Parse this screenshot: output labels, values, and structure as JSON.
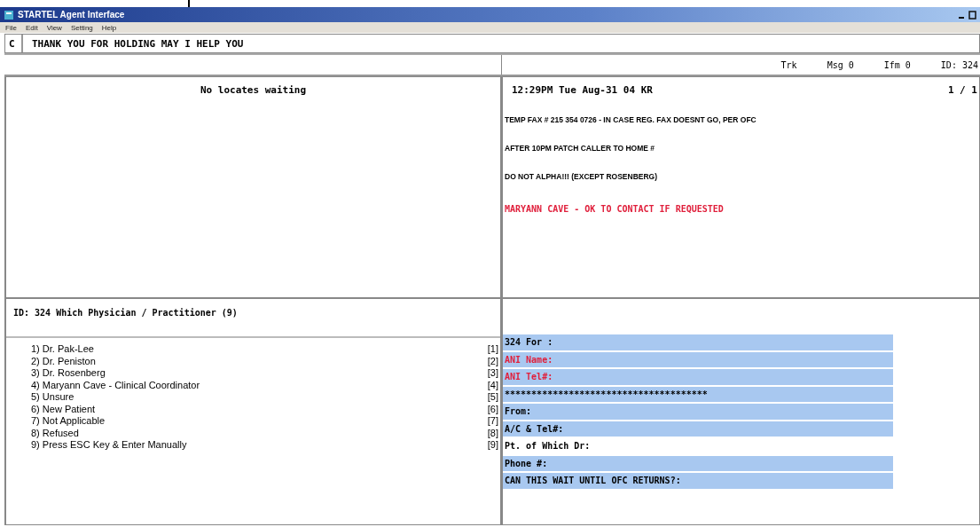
{
  "window": {
    "title": "STARTEL Agent Interface"
  },
  "menu": [
    "File",
    "Edit",
    "View",
    "Setting",
    "Help"
  ],
  "message_bar": {
    "code": "C",
    "text": "THANK YOU FOR HOLDING MAY I HELP YOU"
  },
  "status": [
    "Trk",
    "Msg 0",
    "Ifm 0",
    "ID: 324"
  ],
  "locates": {
    "text": "No locates waiting"
  },
  "info": {
    "header": "12:29PM Tue Aug-31 04 KR",
    "page": "1 / 1",
    "notes": [
      {
        "text": "TEMP FAX # 215 354 0726 - IN CASE REG. FAX DOESNT GO, PER OFC",
        "color": "#000000"
      },
      {
        "text": "AFTER 10PM PATCH CALLER TO HOME #",
        "color": "#000000"
      },
      {
        "text": "DO NOT ALPHA!!! (EXCEPT ROSENBERG)",
        "color": "#000000"
      },
      {
        "text": "MARYANN CAVE - OK TO CONTACT IF REQUESTED",
        "color": "#e0203c"
      }
    ]
  },
  "question": {
    "title": "ID: 324 Which Physician / Practitioner (9)",
    "options": [
      {
        "label": "1) Dr. Pak-Lee",
        "key": "[1]"
      },
      {
        "label": "2) Dr. Peniston",
        "key": "[2]"
      },
      {
        "label": "3) Dr. Rosenberg",
        "key": "[3]"
      },
      {
        "label": "4) Maryann Cave - Clinical Coordinator",
        "key": "[4]"
      },
      {
        "label": "5) Unsure",
        "key": "[5]"
      },
      {
        "label": "6) New Patient",
        "key": "[6]"
      },
      {
        "label": "7) Not Applicable",
        "key": "[7]"
      },
      {
        "label": "8) Refused",
        "key": "[8]"
      },
      {
        "label": "9) Press ESC Key & Enter Manually",
        "key": "[9]"
      }
    ]
  },
  "form": [
    {
      "label": "324 For :",
      "color": "#000000",
      "highlighted": true
    },
    {
      "label": "ANI Name:",
      "color": "#e0203c",
      "highlighted": true
    },
    {
      "label": "ANI Tel#:",
      "color": "#e0203c",
      "highlighted": true
    },
    {
      "label": "**************************************",
      "color": "#000000",
      "highlighted": true
    },
    {
      "label": "From:",
      "color": "#000000",
      "highlighted": true
    },
    {
      "label": "A/C & Tel#:",
      "color": "#000000",
      "highlighted": true
    },
    {
      "label": "Pt. of Which Dr:",
      "color": "#000000",
      "highlighted": false
    },
    {
      "label": "Phone #:",
      "color": "#000000",
      "highlighted": true
    },
    {
      "label": "CAN THIS WAIT UNTIL OFC RETURNS?:",
      "color": "#000000",
      "highlighted": true
    }
  ]
}
